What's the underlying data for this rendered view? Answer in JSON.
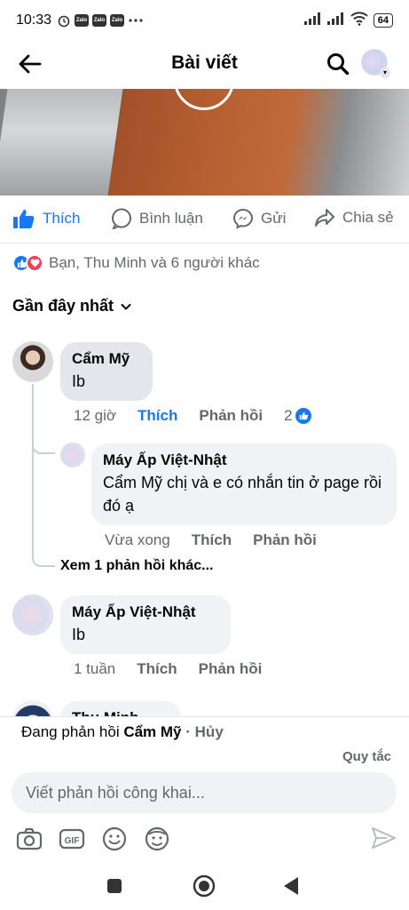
{
  "status_bar": {
    "time": "10:33",
    "zalo": "Zalo",
    "battery": "64"
  },
  "header": {
    "title": "Bài viết"
  },
  "post_actions": {
    "like": "Thích",
    "comment": "Bình luận",
    "send": "Gửi",
    "share": "Chia sẻ"
  },
  "reactions_summary": "Bạn, Thu Minh và 6 người khác",
  "sort_label": "Gần đây nhất",
  "comments": [
    {
      "author": "Cẩm Mỹ",
      "text": "Ib",
      "time": "12 giờ",
      "like": "Thích",
      "reply": "Phản hồi",
      "like_count": "2",
      "replies": [
        {
          "author": "Máy Ấp Việt-Nhật",
          "text": "Cẩm Mỹ chị và e có nhắn tin ở page rồi đó ạ",
          "time": "Vừa xong",
          "like": "Thích",
          "reply": "Phản hồi"
        }
      ],
      "more_replies": "Xem 1 phản hồi khác..."
    },
    {
      "author": "Máy Ấp Việt-Nhật",
      "text": "Ib",
      "time": "1 tuần",
      "like": "Thích",
      "reply": "Phản hồi"
    },
    {
      "author": "Thu Minh"
    }
  ],
  "composer": {
    "replying_prefix": "Đang phản hồi",
    "replying_to": "Cẩm Mỹ",
    "separator": "·",
    "cancel": "Hủy",
    "rules": "Quy tắc",
    "placeholder": "Viết phản hồi công khai..."
  },
  "composer_tools": {
    "gif": "GIF"
  },
  "colors": {
    "accent": "#1877f2",
    "secondary_text": "#65676b",
    "bubble": "#f0f2f5"
  }
}
